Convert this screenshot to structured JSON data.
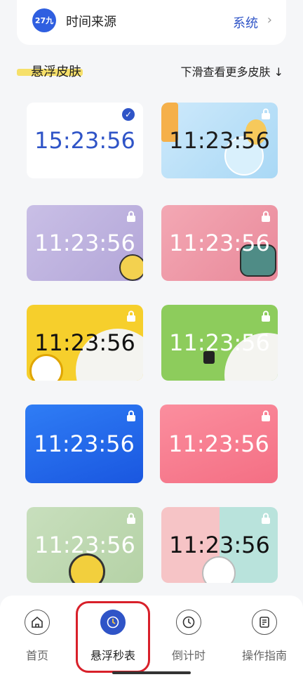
{
  "header": {
    "logo_text": "27九",
    "label": "时间来源",
    "value": "系统",
    "arrow": "›"
  },
  "section": {
    "title": "悬浮皮肤",
    "hint": "下滑查看更多皮肤 ↓"
  },
  "skins": [
    {
      "time": "15:23:56",
      "selected": true
    },
    {
      "time": "11:23:56",
      "locked": true
    },
    {
      "time": "11:23:56",
      "locked": true
    },
    {
      "time": "11:23:56",
      "locked": true
    },
    {
      "time": "11:23:56",
      "locked": true
    },
    {
      "time": "11:23:56",
      "locked": true
    },
    {
      "time": "11:23:56",
      "locked": true
    },
    {
      "time": "11:23:56",
      "locked": true
    },
    {
      "time": "11:23:56",
      "locked": true
    },
    {
      "time": "11:23:56",
      "locked": true
    }
  ],
  "tabs": [
    {
      "label": "首页",
      "icon": "home-icon"
    },
    {
      "label": "悬浮秒表",
      "icon": "stopwatch-icon",
      "active": true
    },
    {
      "label": "倒计时",
      "icon": "clock-icon"
    },
    {
      "label": "操作指南",
      "icon": "guide-icon"
    }
  ],
  "colors": {
    "accent": "#2f54c7",
    "highlight": "#d8202a"
  }
}
